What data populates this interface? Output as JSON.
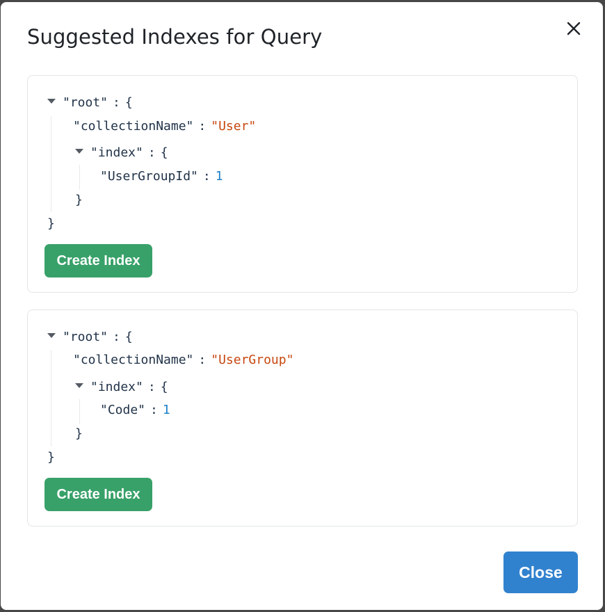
{
  "dialog": {
    "title": "Suggested Indexes for Query",
    "close_icon": "close-icon",
    "close_button_label": "Close"
  },
  "suggestions": [
    {
      "root_key": "\"root\"",
      "collection_key": "\"collectionName\"",
      "collection_value": "\"User\"",
      "index_key": "\"index\"",
      "field_key": "\"UserGroupId\"",
      "field_value": "1",
      "open_brace": "{",
      "close_brace": "}",
      "colon": ":",
      "button_label": "Create Index"
    },
    {
      "root_key": "\"root\"",
      "collection_key": "\"collectionName\"",
      "collection_value": "\"UserGroup\"",
      "index_key": "\"index\"",
      "field_key": "\"Code\"",
      "field_value": "1",
      "open_brace": "{",
      "close_brace": "}",
      "colon": ":",
      "button_label": "Create Index"
    }
  ],
  "colors": {
    "create_button": "#38a169",
    "close_button": "#3182ce",
    "string_value": "#c6470f",
    "number_value": "#1c7fc7"
  }
}
